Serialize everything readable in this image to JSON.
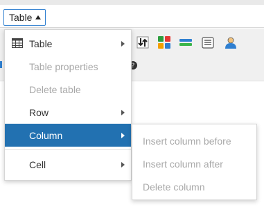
{
  "menubar": {
    "menu_label": "Table"
  },
  "menu": {
    "items": [
      {
        "label": "Table",
        "icon": "table-grid-icon",
        "state": "enabled",
        "has_submenu": true
      },
      {
        "label": "Table properties",
        "state": "disabled",
        "has_submenu": false
      },
      {
        "label": "Delete table",
        "state": "disabled",
        "has_submenu": false
      },
      {
        "label": "Row",
        "state": "enabled",
        "has_submenu": true
      },
      {
        "label": "Column",
        "state": "active",
        "has_submenu": true
      },
      {
        "label": "Cell",
        "state": "enabled",
        "has_submenu": true
      }
    ]
  },
  "submenu": {
    "items": [
      {
        "label": "Insert column before",
        "state": "disabled"
      },
      {
        "label": "Insert column after",
        "state": "disabled"
      },
      {
        "label": "Delete column",
        "state": "disabled"
      }
    ]
  },
  "colors": {
    "accent": "#2271b1",
    "button_border": "#2f7fd0",
    "disabled_text": "#a8a8a8",
    "toolbar_bg": "#f0f0f0"
  },
  "toolbar_icons": [
    "sort-arrows-icon",
    "color-blocks-icon",
    "bars-icon",
    "list-icon",
    "user-icon",
    "help-icon"
  ]
}
